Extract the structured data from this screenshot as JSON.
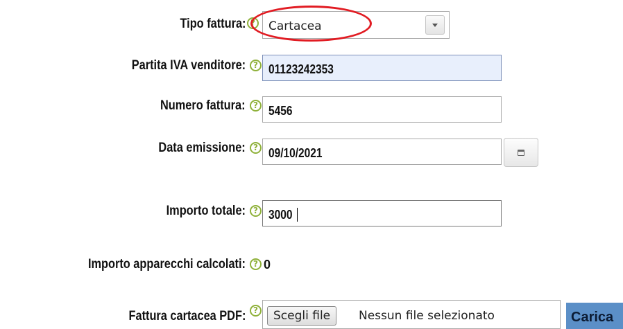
{
  "form": {
    "tipo_fattura": {
      "label": "Tipo fattura:",
      "value": "Cartacea"
    },
    "partita_iva": {
      "label": "Partita IVA venditore:",
      "value": "01123242353"
    },
    "numero_fattura": {
      "label": "Numero fattura:",
      "value": "5456"
    },
    "data_emissione": {
      "label": "Data emissione:",
      "value": "09/10/2021"
    },
    "importo_totale": {
      "label": "Importo totale:",
      "value": "3000"
    },
    "importo_apparecchi": {
      "label": "Importo apparecchi calcolati:",
      "value": "0"
    },
    "fattura_pdf": {
      "label": "Fattura cartacea PDF:",
      "choose_button": "Scegli file",
      "file_status": "Nessun file selezionato",
      "upload_button": "Carica"
    },
    "help_glyph": "?"
  },
  "colors": {
    "help_icon": "#8fb13a",
    "highlight_ellipse": "#e11b22",
    "autofill_bg": "#e8effc",
    "upload_button_bg": "#5b8fc7"
  }
}
